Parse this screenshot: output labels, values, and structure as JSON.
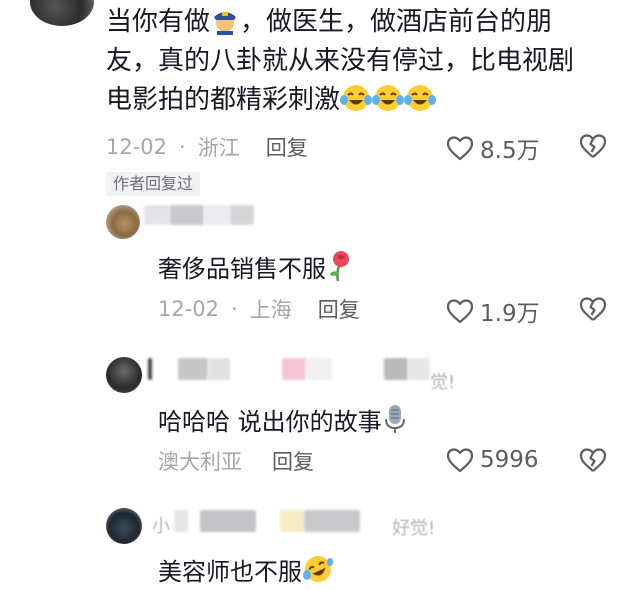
{
  "comment_main": {
    "text_line1": "当你有做",
    "text_line1b": "，做医生，做酒店前台的朋",
    "text_line2": "友，真的八卦就从来没有停过，比电视剧",
    "text_line3": "电影拍的都精彩刺激",
    "date": "12-02",
    "location": "浙江",
    "reply_label": "回复",
    "likes": "8.5万"
  },
  "reply1": {
    "author_tag": "作者回复过",
    "text": "奢侈品销售不服",
    "date": "12-02",
    "location": "上海",
    "reply_label": "回复",
    "likes": "1.9万"
  },
  "reply2": {
    "username_suffix": "觉!",
    "text": "哈哈哈 说出你的故事",
    "location": "澳大利亚",
    "reply_label": "回复",
    "likes": "5996"
  },
  "reply3": {
    "username_prefix": "小",
    "username_suffix": "好觉!",
    "text": "美容师也不服"
  },
  "icons": {
    "police": "police-officer-emoji",
    "laugh": "tears-of-joy-emoji",
    "rose": "wilted-rose-emoji",
    "mic": "microphone-emoji",
    "rofl": "rolling-laughing-emoji",
    "heart": "heart-outline-icon",
    "broken_heart": "broken-heart-icon"
  },
  "colors": {
    "text": "#161823",
    "meta": "#a4a6ad",
    "tag_bg": "#f2f2f4"
  }
}
